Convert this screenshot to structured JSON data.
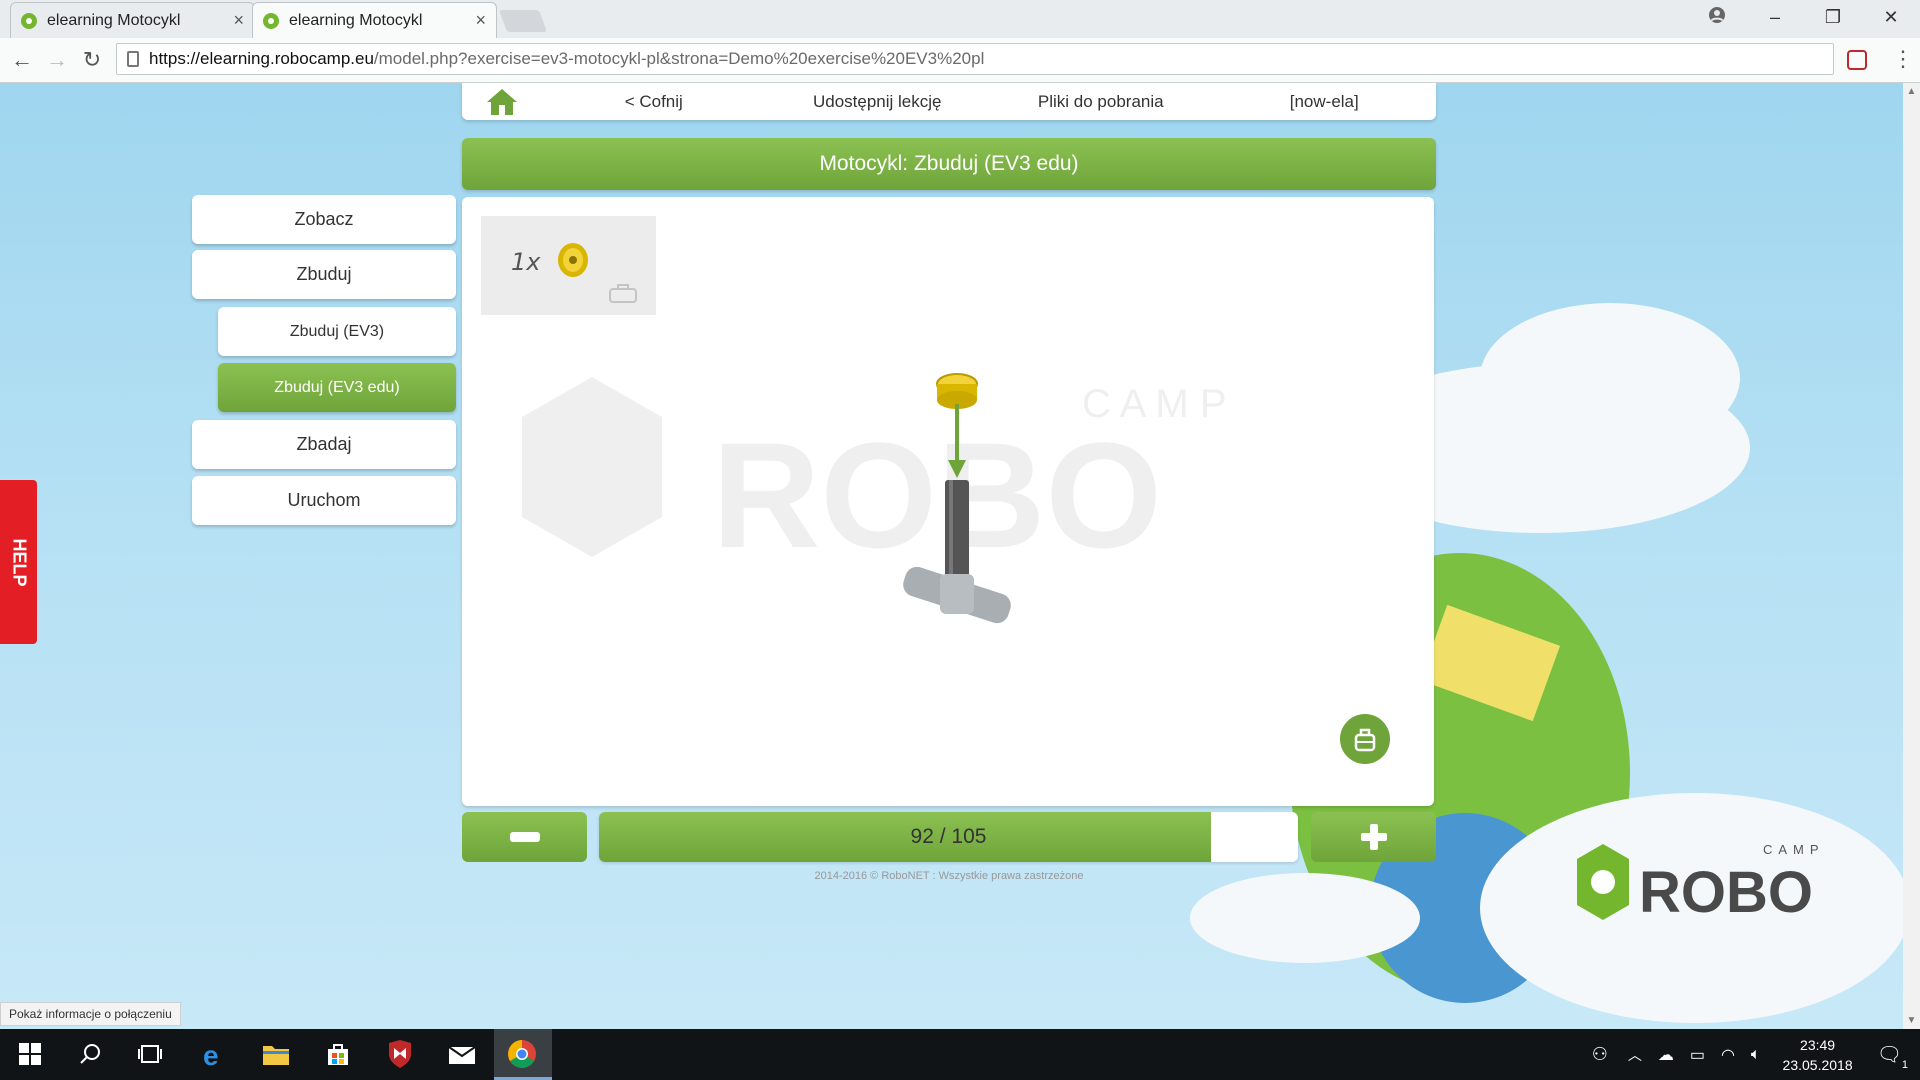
{
  "browser": {
    "tabs": [
      {
        "title": "elearning Motocykl",
        "close": "×",
        "active": false
      },
      {
        "title": "elearning Motocykl",
        "close": "×",
        "active": true
      }
    ],
    "url_host": "https://elearning.robocamp.eu",
    "url_rest": "/model.php?exercise=ev3-motocykl-pl&strona=Demo%20exercise%20EV3%20pl",
    "window_controls": [
      "–",
      "❐",
      "✕"
    ]
  },
  "topnav": {
    "back": "< Cofnij",
    "share": "Udostępnij lekcję",
    "downloads": "Pliki do pobrania",
    "user": "[now-ela]"
  },
  "title": "Motocykl: Zbuduj (EV3 edu)",
  "sidebar": {
    "items": [
      {
        "label": "Zobacz"
      },
      {
        "label": "Zbuduj"
      },
      {
        "label": "Zbuduj (EV3)"
      },
      {
        "label": "Zbuduj (EV3 edu)"
      },
      {
        "label": "Zbadaj"
      },
      {
        "label": "Uruchom"
      }
    ]
  },
  "help": "HELP",
  "parts": {
    "quantity": "1x"
  },
  "watermark": {
    "camp": "C A M P",
    "robo": "ROBO"
  },
  "progress": {
    "label": "92 / 105",
    "current": 92,
    "total": 105
  },
  "copyright": "2014-2016 © RoboNET : Wszystkie prawa zastrzeżone",
  "logo": {
    "camp": "CAMP",
    "robo": "ROBO"
  },
  "status_tip": "Pokaż informacje o połączeniu",
  "taskbar": {
    "time": "23:49",
    "date": "23.05.2018",
    "notifications": "1"
  },
  "colors": {
    "accent_green": "#6ea43a",
    "help_red": "#e31e24"
  }
}
